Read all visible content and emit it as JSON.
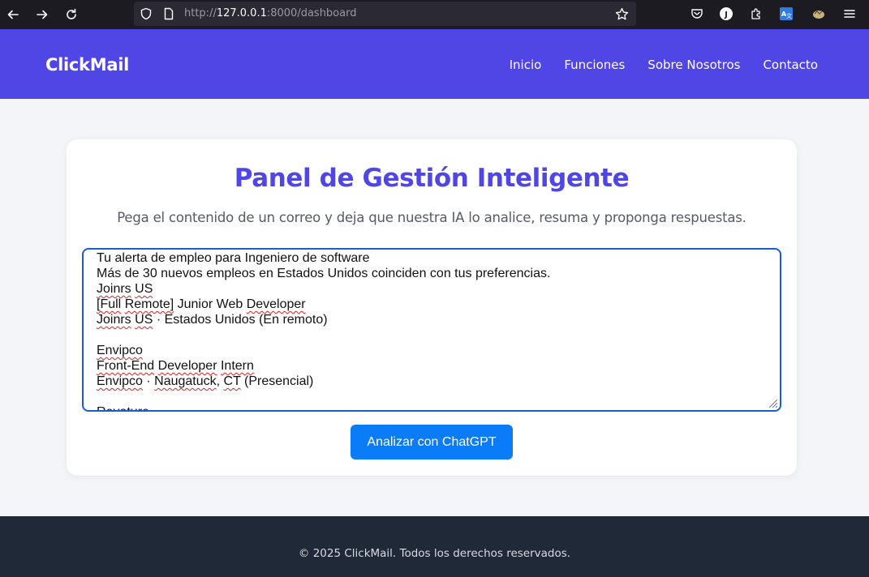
{
  "browser": {
    "url_prefix": "http://",
    "url_host": "127.0.0.1",
    "url_rest": ":8000/dashboard"
  },
  "header": {
    "brand": "ClickMail",
    "nav": [
      "Inicio",
      "Funciones",
      "Sobre Nosotros",
      "Contacto"
    ]
  },
  "main": {
    "title": "Panel de Gestión Inteligente",
    "subtitle": "Pega el contenido de un correo y deja que nuestra IA lo analice, resuma y proponga respuestas.",
    "email_lines": [
      "Tu alerta de empleo para Ingeniero de software",
      "Más de 30 nuevos empleos en Estados Unidos coinciden con tus preferencias.",
      "Joinrs US",
      "[Full Remote] Junior Web Developer",
      "Joinrs US · Estados Unidos (En remoto)",
      "",
      "Envipco",
      "Front-End Developer Intern",
      "Envipco · Naugatuck, CT (Presencial)",
      "",
      "Revature"
    ],
    "analyze_button": "Analizar con ChatGPT"
  },
  "footer": {
    "text": "© 2025 ClickMail. Todos los derechos reservados."
  },
  "colors": {
    "primary": "#4f46e5",
    "button": "#0a7cf7",
    "footer_bg": "#1f2937",
    "page_bg": "#f4f5f9"
  },
  "icons": [
    "back-icon",
    "forward-icon",
    "reload-icon",
    "shield-icon",
    "page-icon",
    "star-icon",
    "pocket-icon",
    "account-icon",
    "extensions-icon",
    "translate-icon",
    "extension-icon",
    "menu-icon"
  ]
}
